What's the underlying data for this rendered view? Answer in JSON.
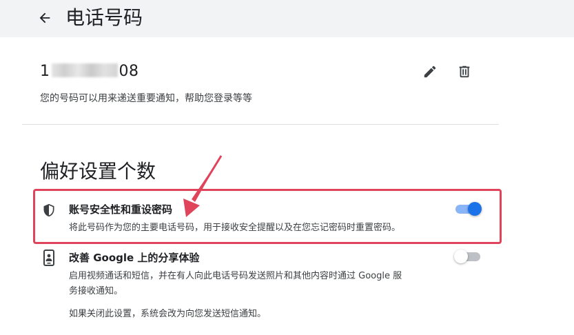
{
  "header": {
    "title": "电话号码",
    "back_icon": "arrow-back-icon"
  },
  "phone": {
    "number_prefix": "1",
    "number_suffix": "08",
    "description": "您的号码可以用来递送重要通知，帮助您登录等等",
    "edit_icon": "pencil-icon",
    "delete_icon": "trash-icon"
  },
  "preferences": {
    "title": "偏好设置个数",
    "items": [
      {
        "title": "账号安全性和重设密码",
        "description": "将此号码作为您的主要电话号码，用于接收安全提醒以及在您忘记密码时重置密码。",
        "icon": "shield-icon",
        "enabled": true
      },
      {
        "title": "改善 Google 上的分享体验",
        "description_line1": "启用视频通话和短信，并在有人向此电话号码发送照片和其他内容时通过 Google 服",
        "description_line2": "务接收通知。",
        "note": "如果关闭此设置，系统会改为向您发送短信通知。",
        "icon": "phone-share-icon",
        "enabled": false
      }
    ]
  },
  "colors": {
    "accent": "#1a73e8",
    "annotation": "#e0445b",
    "header_bg": "#f1f3f4"
  }
}
